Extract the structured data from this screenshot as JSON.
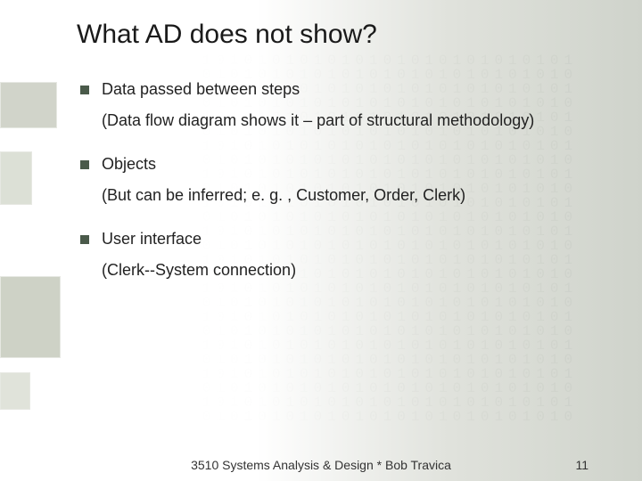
{
  "title": "What AD does not show?",
  "items": [
    {
      "heading": "Data passed between steps",
      "detail": "(Data flow diagram shows it – part of structural methodology)"
    },
    {
      "heading": "Objects",
      "detail": "(But can be inferred; e. g. , Customer, Order, Clerk)"
    },
    {
      "heading": "User interface",
      "detail": "(Clerk--System connection)"
    }
  ],
  "footer": "3510 Systems Analysis & Design * Bob Travica",
  "page_number": "11",
  "bullet_color": "#4a5a4a"
}
